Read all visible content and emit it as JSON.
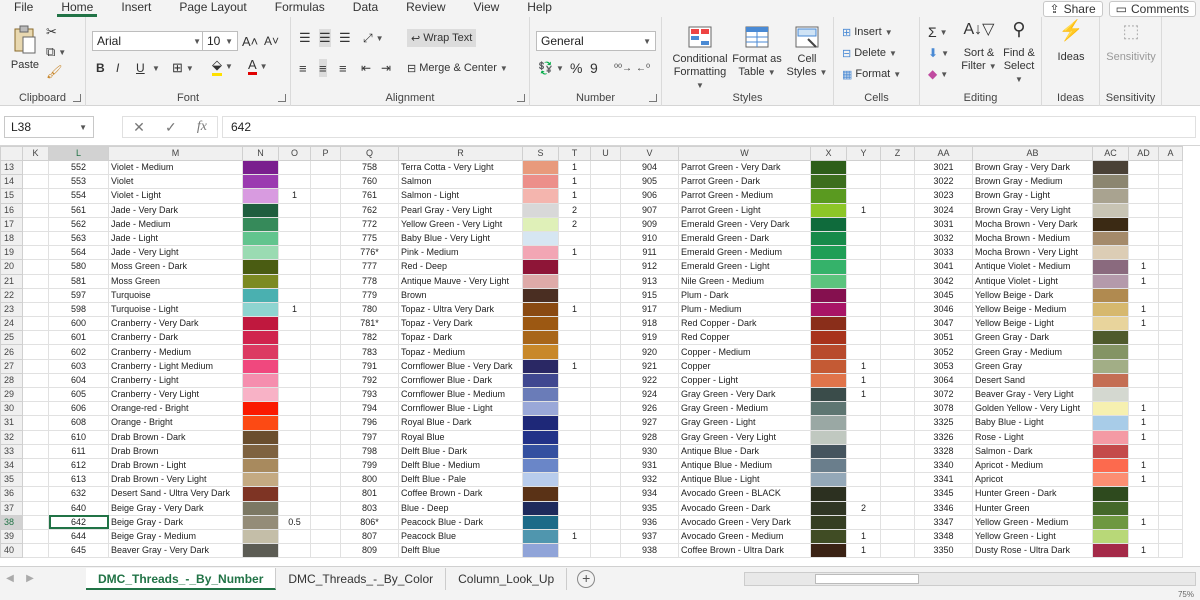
{
  "menu": {
    "items": [
      "File",
      "Home",
      "Insert",
      "Page Layout",
      "Formulas",
      "Data",
      "Review",
      "View",
      "Help"
    ],
    "share": "Share",
    "comments": "Comments"
  },
  "ribbon": {
    "clipboard": {
      "label": "Clipboard",
      "paste": "Paste"
    },
    "font": {
      "label": "Font",
      "name": "Arial",
      "size": "10",
      "bold": "B",
      "italic": "I",
      "underline": "U"
    },
    "alignment": {
      "label": "Alignment",
      "wrap": "Wrap Text",
      "merge": "Merge & Center"
    },
    "number": {
      "label": "Number",
      "format": "General",
      "percent": "%",
      "comma": "9"
    },
    "styles": {
      "label": "Styles",
      "conditional": "Conditional",
      "conditional2": "Formatting",
      "format_as": "Format as",
      "format_as2": "Table",
      "cell": "Cell",
      "cell2": "Styles"
    },
    "cells": {
      "label": "Cells",
      "insert": "Insert",
      "delete": "Delete",
      "format": "Format"
    },
    "editing": {
      "label": "Editing",
      "sort": "Sort &",
      "sort2": "Filter",
      "find": "Find &",
      "find2": "Select"
    },
    "ideas": {
      "label": "Ideas",
      "btn": "Ideas"
    },
    "sensitivity": {
      "label": "Sensitivity",
      "btn": "Sensitivity"
    }
  },
  "formula_bar": {
    "name_box": "L38",
    "fx": "fx",
    "value": "642"
  },
  "columns": [
    "K",
    "L",
    "M",
    "N",
    "O",
    "P",
    "Q",
    "R",
    "S",
    "T",
    "U",
    "V",
    "W",
    "X",
    "Y",
    "Z",
    "AA",
    "AB",
    "AC",
    "AD",
    "A"
  ],
  "selected": {
    "row": 38,
    "col": "L"
  },
  "rows": [
    {
      "n": 13,
      "l": "552",
      "m": "Violet - Medium",
      "nc": "#7a1f8e",
      "o": "",
      "q": "758",
      "r": "Terra Cotta - Very Light",
      "sc": "#e89a7c",
      "t": "1",
      "v": "904",
      "w": "Parrot Green - Very Dark",
      "xc": "#2e5e1a",
      "y": "",
      "aa": "3021",
      "ab": "Brown Gray - Very Dark",
      "acc": "#4a4136",
      "ad": ""
    },
    {
      "n": 14,
      "l": "553",
      "m": "Violet",
      "nc": "#9b3bb0",
      "o": "",
      "q": "760",
      "r": "Salmon",
      "sc": "#ec8f8a",
      "t": "1",
      "v": "905",
      "w": "Parrot Green - Dark",
      "xc": "#3c6e1e",
      "y": "",
      "aa": "3022",
      "ab": "Brown Gray - Medium",
      "acc": "#8c8670",
      "ad": ""
    },
    {
      "n": 15,
      "l": "554",
      "m": "Violet - Light",
      "nc": "#d89be0",
      "o": "1",
      "q": "761",
      "r": "Salmon - Light",
      "sc": "#f4b5ae",
      "t": "1",
      "v": "906",
      "w": "Parrot Green - Medium",
      "xc": "#5a9a20",
      "y": "",
      "aa": "3023",
      "ab": "Brown Gray - Light",
      "acc": "#a9a390",
      "ad": ""
    },
    {
      "n": 16,
      "l": "561",
      "m": "Jade - Very Dark",
      "nc": "#1f5e3e",
      "o": "",
      "q": "762",
      "r": "Pearl Gray - Very Light",
      "sc": "#d8d8d8",
      "t": "2",
      "v": "907",
      "w": "Parrot Green - Light",
      "xc": "#8dc628",
      "y": "1",
      "aa": "3024",
      "ab": "Brown Gray - Very Light",
      "acc": "#c8c4b4",
      "ad": ""
    },
    {
      "n": 17,
      "l": "562",
      "m": "Jade - Medium",
      "nc": "#368a5a",
      "o": "",
      "q": "772",
      "r": "Yellow Green - Very Light",
      "sc": "#dff0b8",
      "t": "2",
      "v": "909",
      "w": "Emerald Green - Very Dark",
      "xc": "#0f6b3c",
      "y": "",
      "aa": "3031",
      "ab": "Mocha Brown - Very Dark",
      "acc": "#3b2a14",
      "ad": ""
    },
    {
      "n": 18,
      "l": "563",
      "m": "Jade - Light",
      "nc": "#62c48e",
      "o": "",
      "q": "775",
      "r": "Baby Blue - Very Light",
      "sc": "#d6e6f2",
      "t": "",
      "v": "910",
      "w": "Emerald Green - Dark",
      "xc": "#178a4a",
      "y": "",
      "aa": "3032",
      "ab": "Mocha Brown - Medium",
      "acc": "#a48a6a",
      "ad": ""
    },
    {
      "n": 19,
      "l": "564",
      "m": "Jade - Very Light",
      "nc": "#9adbb2",
      "o": "",
      "q": "776*",
      "r": "Pink - Medium",
      "sc": "#f2a6b4",
      "t": "1",
      "v": "911",
      "w": "Emerald Green - Medium",
      "xc": "#1f9e56",
      "y": "",
      "aa": "3033",
      "ab": "Mocha Brown - Very Light",
      "acc": "#dccdb5",
      "ad": ""
    },
    {
      "n": 20,
      "l": "580",
      "m": "Moss Green - Dark",
      "nc": "#4a5c12",
      "o": "",
      "q": "777",
      "r": "Red - Deep",
      "sc": "#8e1537",
      "t": "",
      "v": "912",
      "w": "Emerald Green - Light",
      "xc": "#35b26a",
      "y": "",
      "aa": "3041",
      "ab": "Antique Violet - Medium",
      "acc": "#8a6a7e",
      "ad": "1"
    },
    {
      "n": 21,
      "l": "581",
      "m": "Moss Green",
      "nc": "#7c8a22",
      "o": "",
      "q": "778",
      "r": "Antique Mauve - Very Light",
      "sc": "#deaaa8",
      "t": "",
      "v": "913",
      "w": "Nile Green - Medium",
      "xc": "#5cc47e",
      "y": "",
      "aa": "3042",
      "ab": "Antique Violet - Light",
      "acc": "#b49aab",
      "ad": "1"
    },
    {
      "n": 22,
      "l": "597",
      "m": "Turquoise",
      "nc": "#4ab0b0",
      "o": "",
      "q": "779",
      "r": "Brown",
      "sc": "#4a2e22",
      "t": "",
      "v": "915",
      "w": "Plum - Dark",
      "xc": "#85104f",
      "y": "",
      "aa": "3045",
      "ab": "Yellow Beige - Dark",
      "acc": "#b08a50",
      "ad": ""
    },
    {
      "n": 23,
      "l": "598",
      "m": "Turquoise - Light",
      "nc": "#8ed4d0",
      "o": "1",
      "q": "780",
      "r": "Topaz - Ultra Very Dark",
      "sc": "#8a4a12",
      "t": "1",
      "v": "917",
      "w": "Plum - Medium",
      "xc": "#a81566",
      "y": "",
      "aa": "3046",
      "ab": "Yellow Beige - Medium",
      "acc": "#d6b86e",
      "ad": "1"
    },
    {
      "n": 24,
      "l": "600",
      "m": "Cranberry - Very Dark",
      "nc": "#c0183e",
      "o": "",
      "q": "781*",
      "r": "Topaz - Very Dark",
      "sc": "#9c5812",
      "t": "",
      "v": "918",
      "w": "Red Copper - Dark",
      "xc": "#8a2e1a",
      "y": "",
      "aa": "3047",
      "ab": "Yellow Beige - Light",
      "acc": "#e8d49c",
      "ad": "1"
    },
    {
      "n": 25,
      "l": "601",
      "m": "Cranberry - Dark",
      "nc": "#d0244e",
      "o": "",
      "q": "782",
      "r": "Topaz - Dark",
      "sc": "#a8661a",
      "t": "",
      "v": "919",
      "w": "Red Copper",
      "xc": "#a8331c",
      "y": "",
      "aa": "3051",
      "ab": "Green Gray - Dark",
      "acc": "#4f5a2c",
      "ad": ""
    },
    {
      "n": 26,
      "l": "602",
      "m": "Cranberry - Medium",
      "nc": "#dc3a62",
      "o": "",
      "q": "783",
      "r": "Topaz - Medium",
      "sc": "#c8882a",
      "t": "",
      "v": "920",
      "w": "Copper - Medium",
      "xc": "#b84a2c",
      "y": "",
      "aa": "3052",
      "ab": "Green Gray - Medium",
      "acc": "#849464",
      "ad": ""
    },
    {
      "n": 27,
      "l": "603",
      "m": "Cranberry - Light Medium",
      "nc": "#f0487e",
      "o": "",
      "q": "791",
      "r": "Cornflower Blue - Very Dark",
      "sc": "#2a2864",
      "t": "1",
      "v": "921",
      "w": "Copper",
      "xc": "#c45a34",
      "y": "1",
      "aa": "3053",
      "ab": "Green Gray",
      "acc": "#a2ae86",
      "ad": ""
    },
    {
      "n": 28,
      "l": "604",
      "m": "Cranberry - Light",
      "nc": "#f58eae",
      "o": "",
      "q": "792",
      "r": "Cornflower Blue - Dark",
      "sc": "#404890",
      "t": "",
      "v": "922",
      "w": "Copper - Light",
      "xc": "#e0744a",
      "y": "1",
      "aa": "3064",
      "ab": "Desert Sand",
      "acc": "#c46e54",
      "ad": ""
    },
    {
      "n": 29,
      "l": "605",
      "m": "Cranberry - Very Light",
      "nc": "#f8b2c6",
      "o": "",
      "q": "793",
      "r": "Cornflower Blue - Medium",
      "sc": "#6a7cb8",
      "t": "",
      "v": "924",
      "w": "Gray Green - Very Dark",
      "xc": "#3a4c4a",
      "y": "1",
      "aa": "3072",
      "ab": "Beaver Gray - Very Light",
      "acc": "#d4d8d0",
      "ad": ""
    },
    {
      "n": 30,
      "l": "606",
      "m": "Orange-red - Bright",
      "nc": "#fa1a00",
      "o": "",
      "q": "794",
      "r": "Cornflower Blue - Light",
      "sc": "#9aa8d8",
      "t": "",
      "v": "926",
      "w": "Gray Green - Medium",
      "xc": "#5e7672",
      "y": "",
      "aa": "3078",
      "ab": "Golden Yellow - Very Light",
      "acc": "#f6f0b0",
      "ad": "1"
    },
    {
      "n": 31,
      "l": "608",
      "m": "Orange - Bright",
      "nc": "#fc4a14",
      "o": "",
      "q": "796",
      "r": "Royal Blue - Dark",
      "sc": "#1e2878",
      "t": "",
      "v": "927",
      "w": "Gray Green - Light",
      "xc": "#9aa8a4",
      "y": "",
      "aa": "3325",
      "ab": "Baby Blue - Light",
      "acc": "#a8cce8",
      "ad": "1"
    },
    {
      "n": 32,
      "l": "610",
      "m": "Drab Brown - Dark",
      "nc": "#6a4e2e",
      "o": "",
      "q": "797",
      "r": "Royal Blue",
      "sc": "#223288",
      "t": "",
      "v": "928",
      "w": "Gray Green - Very Light",
      "xc": "#c0c8c0",
      "y": "",
      "aa": "3326",
      "ab": "Rose - Light",
      "acc": "#f49aa4",
      "ad": "1"
    },
    {
      "n": 33,
      "l": "611",
      "m": "Drab Brown",
      "nc": "#7e6240",
      "o": "",
      "q": "798",
      "r": "Delft Blue - Dark",
      "sc": "#3450a0",
      "t": "",
      "v": "930",
      "w": "Antique Blue - Dark",
      "xc": "#45545e",
      "y": "",
      "aa": "3328",
      "ab": "Salmon - Dark",
      "acc": "#c44a4a",
      "ad": ""
    },
    {
      "n": 34,
      "l": "612",
      "m": "Drab Brown - Light",
      "nc": "#a88a5e",
      "o": "",
      "q": "799",
      "r": "Delft Blue - Medium",
      "sc": "#6a86c8",
      "t": "",
      "v": "931",
      "w": "Antique Blue - Medium",
      "xc": "#6a7e8c",
      "y": "",
      "aa": "3340",
      "ab": "Apricot - Medium",
      "acc": "#fc6a4e",
      "ad": "1"
    },
    {
      "n": 35,
      "l": "613",
      "m": "Drab Brown - Very Light",
      "nc": "#c4aa82",
      "o": "",
      "q": "800",
      "r": "Delft Blue - Pale",
      "sc": "#b8ccec",
      "t": "",
      "v": "932",
      "w": "Antique Blue - Light",
      "xc": "#94a8b8",
      "y": "",
      "aa": "3341",
      "ab": "Apricot",
      "acc": "#fc8e72",
      "ad": "1"
    },
    {
      "n": 36,
      "l": "632",
      "m": "Desert Sand - Ultra Very Dark",
      "nc": "#7e3424",
      "o": "",
      "q": "801",
      "r": "Coffee Brown - Dark",
      "sc": "#5a3216",
      "t": "",
      "v": "934",
      "w": "Avocado Green - BLACK",
      "xc": "#2c3020",
      "y": "",
      "aa": "3345",
      "ab": "Hunter Green - Dark",
      "acc": "#2e4a1e",
      "ad": ""
    },
    {
      "n": 37,
      "l": "640",
      "m": "Beige Gray - Very Dark",
      "nc": "#7c7864",
      "o": "",
      "q": "803",
      "r": "Blue - Deep",
      "sc": "#1e2a5c",
      "t": "",
      "v": "935",
      "w": "Avocado Green - Dark",
      "xc": "#303624",
      "y": "2",
      "aa": "3346",
      "ab": "Hunter Green",
      "acc": "#44682a",
      "ad": ""
    },
    {
      "n": 38,
      "l": "642",
      "m": "Beige Gray - Dark",
      "nc": "#948c78",
      "o": "0.5",
      "q": "806*",
      "r": "Peacock Blue - Dark",
      "sc": "#1c6a88",
      "t": "",
      "v": "936",
      "w": "Avocado Green - Very Dark",
      "xc": "#353e22",
      "y": "",
      "aa": "3347",
      "ab": "Yellow Green - Medium",
      "acc": "#6e9840",
      "ad": "1"
    },
    {
      "n": 39,
      "l": "644",
      "m": "Beige Gray - Medium",
      "nc": "#c4bea8",
      "o": "",
      "q": "807",
      "r": "Peacock Blue",
      "sc": "#5096ae",
      "t": "1",
      "v": "937",
      "w": "Avocado Green - Medium",
      "xc": "#404c24",
      "y": "1",
      "aa": "3348",
      "ab": "Yellow Green - Light",
      "acc": "#b8d878",
      "ad": ""
    },
    {
      "n": 40,
      "l": "645",
      "m": "Beaver Gray - Very Dark",
      "nc": "#5c5c54",
      "o": "",
      "q": "809",
      "r": "Delft Blue",
      "sc": "#90a4d8",
      "t": "",
      "v": "938",
      "w": "Coffee Brown - Ultra Dark",
      "xc": "#3a2214",
      "y": "1",
      "aa": "3350",
      "ab": "Dusty Rose - Ultra Dark",
      "acc": "#a42a48",
      "ad": "1"
    }
  ],
  "tabs": [
    "DMC_Threads_-_By_Number",
    "DMC_Threads_-_By_Color",
    "Column_Look_Up"
  ],
  "active_tab": 0,
  "zoom": "75%"
}
